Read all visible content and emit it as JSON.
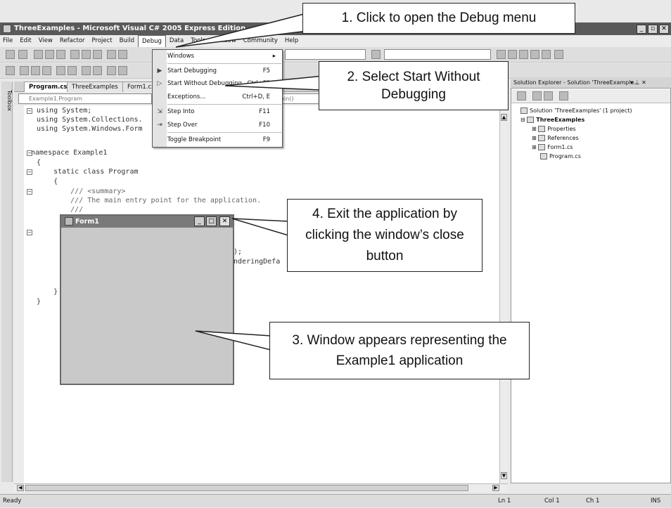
{
  "window": {
    "title": "ThreeExamples - Microsoft Visual C# 2005 Express Edition",
    "minimize": "_",
    "maximize": "▫",
    "close": "✕"
  },
  "menubar": [
    "File",
    "Edit",
    "View",
    "Refactor",
    "Project",
    "Build",
    "Debug",
    "Data",
    "Tools",
    "Window",
    "Community",
    "Help"
  ],
  "debug_menu": {
    "items": [
      {
        "label": "Windows",
        "shortcut": "▸"
      },
      {
        "label": "Start Debugging",
        "shortcut": "F5"
      },
      {
        "label": "Start Without Debugging",
        "shortcut": "Ctrl+F5"
      },
      {
        "label": "Exceptions...",
        "shortcut": "Ctrl+D, E"
      },
      {
        "label": "Step Into",
        "shortcut": "F11"
      },
      {
        "label": "Step Over",
        "shortcut": "F10"
      },
      {
        "label": "Toggle Breakpoint",
        "shortcut": "F9"
      }
    ]
  },
  "toolbox": {
    "label": "Toolbox"
  },
  "editor": {
    "tabs": [
      "Program.cs",
      "ThreeExamples",
      "Form1.cs"
    ],
    "nav_left": "Example1.Program",
    "nav_right": "ain()",
    "code": [
      "using System;",
      "using System.Collections.",
      "using System.Windows.Form",
      "",
      "namespace Example1",
      "{",
      "    static class Program",
      "    {",
      "        /// <summary>",
      "        /// The main entry point for the application.",
      "        ///"
    ],
    "partial_code_1": ");",
    "partial_code_2": "nderingDefa",
    "close_brace_inner": "    }",
    "close_brace_outer": "}"
  },
  "solution_explorer": {
    "header": "Solution Explorer - Solution 'ThreeExample...",
    "pin": "▾ ⊥ ✕",
    "solution": "Solution 'ThreeExamples' (1 project)",
    "project": "ThreeExamples",
    "items": [
      "Properties",
      "References",
      "Form1.cs",
      "Program.cs"
    ]
  },
  "form1": {
    "title": "Form1",
    "minimize": "_",
    "maximize": "□",
    "close": "✕"
  },
  "statusbar": {
    "left": "Ready",
    "ln": "Ln 1",
    "col": "Col 1",
    "ch": "Ch 1",
    "ins": "INS"
  },
  "callouts": {
    "step1": "1. Click to open the Debug menu",
    "step2": "2. Select Start Without Debugging",
    "step3": "3. Window appears representing the Example1 application",
    "step4": "4. Exit the application by clicking the window’s close button"
  }
}
